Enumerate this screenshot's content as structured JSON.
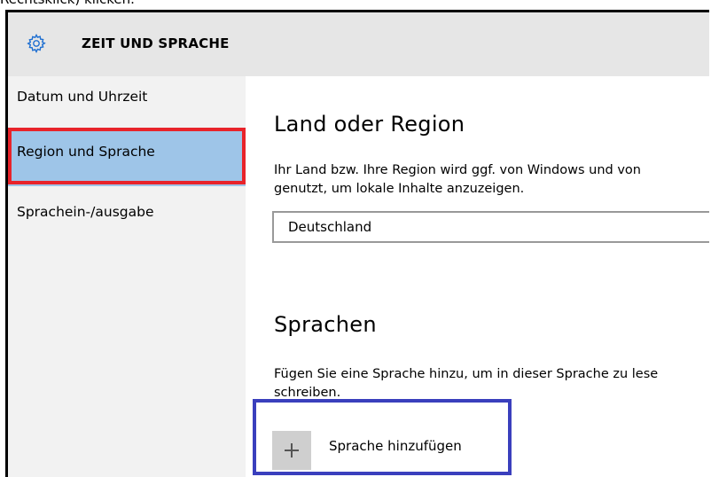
{
  "caption": "Rechtsklick) klicken.",
  "header": {
    "title": "ZEIT UND SPRACHE",
    "icon": "gear-icon"
  },
  "sidebar": {
    "items": [
      {
        "label": "Datum und Uhrzeit"
      },
      {
        "label": "Region und Sprache",
        "selected": true
      },
      {
        "label": "Sprachein-/ausgabe"
      }
    ]
  },
  "region": {
    "heading": "Land oder Region",
    "description_line1": "Ihr Land bzw. Ihre Region wird ggf. von Windows und von",
    "description_line2": "genutzt, um lokale Inhalte anzuzeigen.",
    "selected_value": "Deutschland"
  },
  "languages": {
    "heading": "Sprachen",
    "description_line1": "Fügen Sie eine Sprache hinzu, um in dieser Sprache zu lese",
    "description_line2": "schreiben.",
    "add_label": "Sprache hinzufügen"
  },
  "colors": {
    "header_bg": "#e6e6e6",
    "sidebar_bg": "#f2f2f2",
    "selected_bg": "#9ec5e8",
    "highlight_red": "#e8232a",
    "highlight_blue": "#3a3fbd"
  }
}
